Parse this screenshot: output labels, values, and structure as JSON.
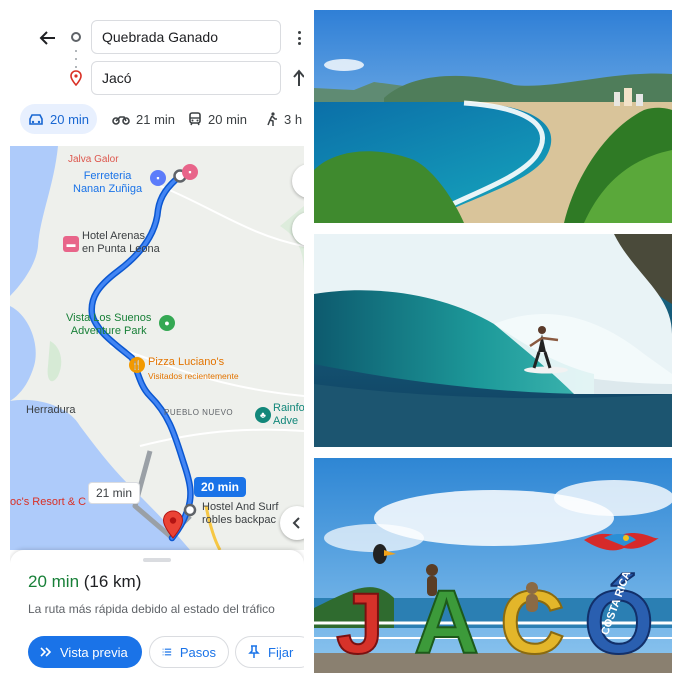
{
  "directions": {
    "origin": "Quebrada Ganado",
    "destination": "Jacó",
    "modes": [
      {
        "icon": "car-icon",
        "label": "20 min",
        "active": true
      },
      {
        "icon": "motorcycle-icon",
        "label": "21 min",
        "active": false
      },
      {
        "icon": "transit-icon",
        "label": "20 min",
        "active": false
      },
      {
        "icon": "walk-icon",
        "label": "3 h",
        "active": false
      }
    ]
  },
  "map": {
    "places": {
      "ferreteria": "Ferreteria\nNanan Zuñiga",
      "hotel_arenas": "Hotel Arenas\nen Punta Leona",
      "vista_los_suenos": "Vista Los Suenos\nAdventure Park",
      "pizza": "Pizza Luciano's",
      "pizza_sub": "Visitados recientemente",
      "herradura": "Herradura",
      "pueblo_nuevo": "PUEBLO NUEVO",
      "rainforest": "Rainfo\nAdve",
      "resort": "oc's Resort & C",
      "hostel": "Hostel And Surf\nrobles backpac",
      "top_cut": "Jalva Galor"
    },
    "callouts": {
      "main": "20 min",
      "alt": "21 min"
    },
    "colors": {
      "route": "#1a73e8",
      "alt_route": "#9aa0a6",
      "water": "#aecbfa",
      "land": "#eef0ec"
    }
  },
  "sheet": {
    "eta_time": "20 min",
    "eta_distance": "(16 km)",
    "description": "La ruta más rápida debido al estado del tráfico",
    "buttons": {
      "preview": "Vista previa",
      "steps": "Pasos",
      "pin": "Fijar"
    }
  },
  "photos": {
    "sign_letters": [
      "J",
      "A",
      "C",
      "Ó"
    ],
    "sign_costa_rica": "COSTA RICA"
  }
}
